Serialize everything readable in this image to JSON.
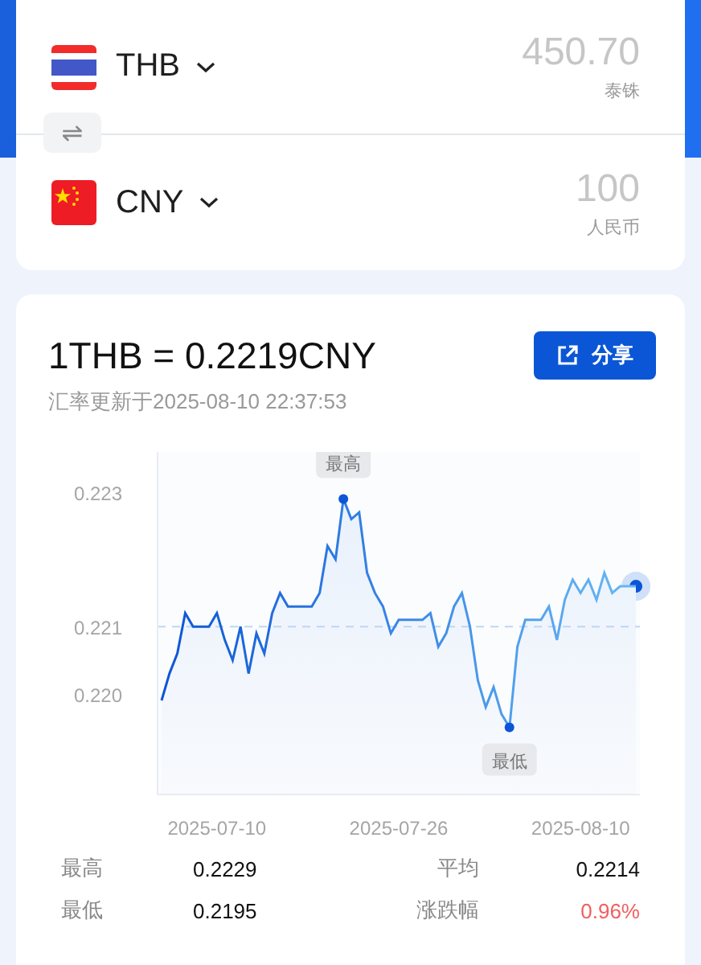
{
  "converter": {
    "rows": [
      {
        "kind": "thailand",
        "code": "THB",
        "amount": "450.70",
        "name": "泰铢"
      },
      {
        "kind": "china",
        "code": "CNY",
        "amount": "100",
        "name": "人民币"
      }
    ],
    "swap": "⇌"
  },
  "rate": {
    "title": "1THB = 0.2219CNY",
    "share": "分享",
    "updated": "汇率更新于2025-08-10 22:37:53"
  },
  "chart": {
    "chart_data": {
      "type": "area",
      "categories": [
        null,
        null,
        null,
        null,
        null,
        null,
        null,
        "2025-07-10",
        null,
        null,
        null,
        null,
        null,
        null,
        null,
        null,
        null,
        null,
        null,
        null,
        null,
        null,
        null,
        null,
        null,
        null,
        null,
        null,
        null,
        null,
        "2025-07-26",
        null,
        null,
        null,
        null,
        null,
        null,
        null,
        null,
        null,
        null,
        null,
        null,
        null,
        null,
        null,
        null,
        null,
        null,
        null,
        null,
        null,
        null,
        "2025-08-10",
        null,
        null,
        null,
        null,
        null,
        null,
        null
      ],
      "series": [
        {
          "color": "#0b55d6",
          "values": [
            0.2199,
            0.2203,
            0.2206,
            0.2212,
            0.221,
            0.221,
            0.221,
            0.2212,
            0.2208,
            0.2205,
            0.221,
            0.2203,
            0.2209,
            0.2206,
            0.2212,
            0.2215,
            0.2213,
            0.2213,
            0.2213,
            0.2213,
            0.2215,
            0.2222,
            0.222,
            0.2229,
            0.2226,
            0.2227,
            0.2218,
            0.2215,
            0.2213,
            0.2209,
            0.2211,
            0.2211,
            0.2211,
            0.2211,
            0.2212,
            0.2207,
            0.2209,
            0.2213,
            0.2215,
            0.221,
            0.2202,
            0.2198,
            0.2201,
            0.2197,
            0.2195,
            0.2207,
            0.2211,
            0.2211,
            0.2211,
            0.2213,
            0.2208,
            0.2214,
            0.2217,
            0.2215,
            0.2217,
            0.2214,
            0.2218,
            0.2215,
            0.2216,
            0.2216,
            0.2216
          ]
        }
      ],
      "ylim": [
        0.2185,
        0.2236
      ],
      "yticks": [
        {
          "value": 0.223,
          "label": "0.223"
        },
        {
          "value": 0.221,
          "label": "0.221"
        },
        {
          "value": 0.22,
          "label": "0.220"
        }
      ],
      "ref_lines": [
        {
          "axis": "y",
          "value": 0.221
        }
      ],
      "annotations": [
        {
          "text": "最高",
          "y": 0.2229
        },
        {
          "text": "最低",
          "y": 0.2195
        }
      ]
    }
  },
  "stats": [
    {
      "label": "最高",
      "value": "0.2229",
      "kind": "plain"
    },
    {
      "label": "平均",
      "value": "0.2214",
      "kind": "plain"
    },
    {
      "label": "最低",
      "value": "0.2195",
      "kind": "plain"
    },
    {
      "label": "涨跌幅",
      "value": "0.96%",
      "kind": "change"
    }
  ]
}
